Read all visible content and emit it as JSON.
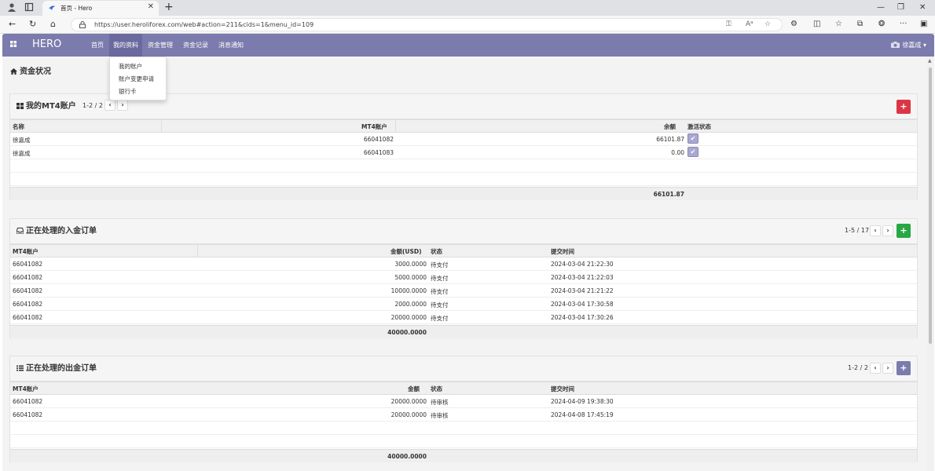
{
  "browser": {
    "tab_title": "首页 - Hero",
    "url": "https://user.heroliforex.com/web#action=211&cids=1&menu_id=109"
  },
  "colors": {
    "nav_bg": "#7c7bad",
    "danger": "#dc3545",
    "success": "#28a745",
    "primary": "#7c7bad"
  },
  "app": {
    "brand": "HERO",
    "menu": [
      "首页",
      "我的资料",
      "资金管理",
      "资金记录",
      "消息通知"
    ],
    "active_menu": "我的资料",
    "user": "徐嘉成"
  },
  "dropdown": {
    "items": [
      "我的账户",
      "账户变更申请",
      "银行卡"
    ]
  },
  "page": {
    "title": "资金状况"
  },
  "mt4_panel": {
    "title": "我的MT4账户",
    "pager": "1-2 / 2",
    "columns": [
      "名称",
      "MT4账户",
      "余额",
      "激活状态"
    ],
    "rows": [
      {
        "name": "徐嘉成",
        "account": "66041082",
        "balance": "66101.87"
      },
      {
        "name": "徐嘉成",
        "account": "66041083",
        "balance": "0.00"
      }
    ],
    "total": "66101.87"
  },
  "deposit_panel": {
    "title": "正在处理的入金订单",
    "pager": "1-5 / 17",
    "columns": [
      "MT4账户",
      "金额(USD)",
      "状态",
      "提交时间"
    ],
    "rows": [
      {
        "account": "66041082",
        "amount": "3000.0000",
        "status": "待支付",
        "time": "2024-03-04 21:22:30"
      },
      {
        "account": "66041082",
        "amount": "5000.0000",
        "status": "待支付",
        "time": "2024-03-04 21:22:03"
      },
      {
        "account": "66041082",
        "amount": "10000.0000",
        "status": "待支付",
        "time": "2024-03-04 21:21:22"
      },
      {
        "account": "66041082",
        "amount": "2000.0000",
        "status": "待支付",
        "time": "2024-03-04 17:30:58"
      },
      {
        "account": "66041082",
        "amount": "20000.0000",
        "status": "待支付",
        "time": "2024-03-04 17:30:26"
      }
    ],
    "total": "40000.0000"
  },
  "withdraw_panel": {
    "title": "正在处理的出金订单",
    "pager": "1-2 / 2",
    "columns": [
      "MT4账户",
      "金额",
      "状态",
      "提交时间"
    ],
    "rows": [
      {
        "account": "66041082",
        "amount": "20000.0000",
        "status": "待审核",
        "time": "2024-04-09 19:38:30"
      },
      {
        "account": "66041082",
        "amount": "20000.0000",
        "status": "待审核",
        "time": "2024-04-08 17:45:19"
      }
    ],
    "total": "40000.0000"
  }
}
